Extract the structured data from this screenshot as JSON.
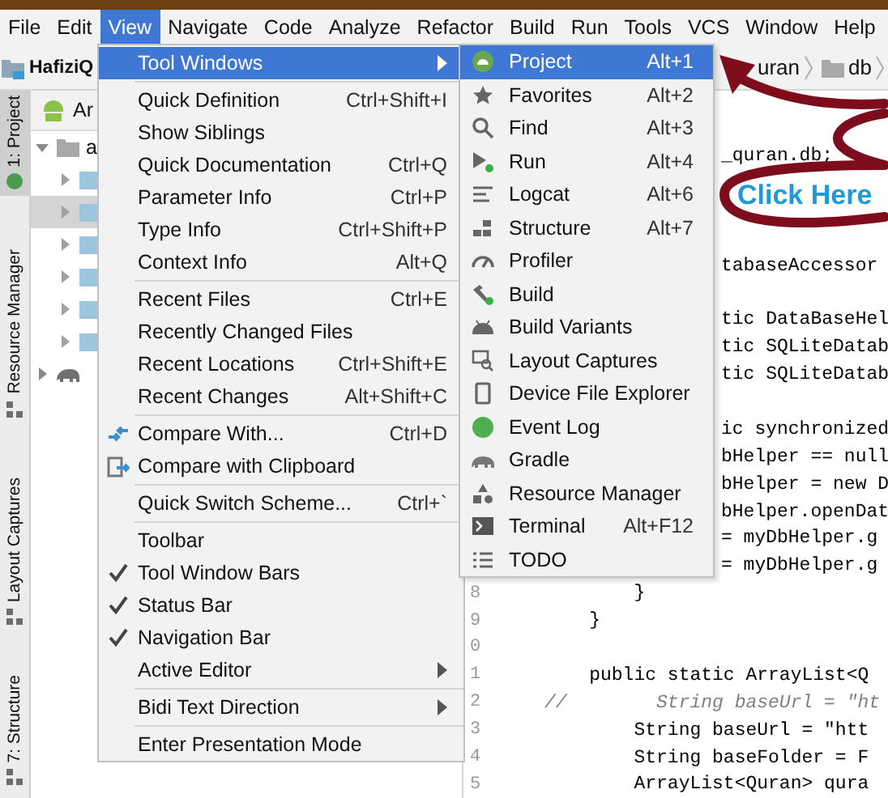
{
  "menu_bar": [
    {
      "label": "File",
      "selected": false
    },
    {
      "label": "Edit",
      "selected": false
    },
    {
      "label": "View",
      "selected": true
    },
    {
      "label": "Navigate",
      "selected": false
    },
    {
      "label": "Code",
      "selected": false
    },
    {
      "label": "Analyze",
      "selected": false
    },
    {
      "label": "Refactor",
      "selected": false
    },
    {
      "label": "Build",
      "selected": false
    },
    {
      "label": "Run",
      "selected": false
    },
    {
      "label": "Tools",
      "selected": false
    },
    {
      "label": "VCS",
      "selected": false
    },
    {
      "label": "Window",
      "selected": false
    },
    {
      "label": "Help",
      "selected": false
    }
  ],
  "nav_bar": {
    "project": "HafiziQ",
    "crumbs": [
      "uran",
      "db"
    ]
  },
  "side_tabs": [
    {
      "label": "1: Project",
      "selected": true
    },
    {
      "label": "Resource Manager",
      "selected": false
    },
    {
      "label": "Layout Captures",
      "selected": false
    },
    {
      "label": "7: Structure",
      "selected": false
    }
  ],
  "project_panel": {
    "header": "Ar",
    "tree": [
      {
        "label": "a",
        "expanded": true,
        "selected": false,
        "children": [
          {
            "expanded": false,
            "selected": false
          },
          {
            "expanded": false,
            "selected": true
          },
          {
            "expanded": false,
            "selected": false
          },
          {
            "expanded": false,
            "selected": false
          },
          {
            "expanded": false,
            "selected": false
          },
          {
            "expanded": false,
            "selected": false
          }
        ]
      },
      {
        "expanded": false,
        "selected": false
      }
    ]
  },
  "view_menu": [
    [
      {
        "label": "Tool Windows",
        "kind": "submenu",
        "selected": true
      }
    ],
    [
      {
        "label": "Quick Definition",
        "shortcut": "Ctrl+Shift+I",
        "kind": "plain",
        "selected": false
      },
      {
        "label": "Show Siblings",
        "kind": "plain",
        "selected": false
      },
      {
        "label": "Quick Documentation",
        "shortcut": "Ctrl+Q",
        "kind": "plain",
        "selected": false
      },
      {
        "label": "Parameter Info",
        "shortcut": "Ctrl+P",
        "kind": "plain",
        "selected": false
      },
      {
        "label": "Type Info",
        "shortcut": "Ctrl+Shift+P",
        "kind": "plain",
        "selected": false
      },
      {
        "label": "Context Info",
        "shortcut": "Alt+Q",
        "kind": "plain",
        "selected": false
      }
    ],
    [
      {
        "label": "Recent Files",
        "shortcut": "Ctrl+E",
        "kind": "plain",
        "selected": false
      },
      {
        "label": "Recently Changed Files",
        "kind": "plain",
        "selected": false
      },
      {
        "label": "Recent Locations",
        "shortcut": "Ctrl+Shift+E",
        "kind": "plain",
        "selected": false
      },
      {
        "label": "Recent Changes",
        "shortcut": "Alt+Shift+C",
        "kind": "plain",
        "selected": false
      }
    ],
    [
      {
        "label": "Compare With...",
        "shortcut": "Ctrl+D",
        "kind": "plain",
        "selected": false
      },
      {
        "label": "Compare with Clipboard",
        "kind": "plain",
        "selected": false
      }
    ],
    [
      {
        "label": "Quick Switch Scheme...",
        "shortcut": "Ctrl+`",
        "kind": "plain",
        "selected": false
      }
    ],
    [
      {
        "label": "Toolbar",
        "kind": "toggle",
        "checked": false,
        "selected": false
      },
      {
        "label": "Tool Window Bars",
        "kind": "toggle",
        "checked": true,
        "selected": false
      },
      {
        "label": "Status Bar",
        "kind": "toggle",
        "checked": true,
        "selected": false
      },
      {
        "label": "Navigation Bar",
        "kind": "toggle",
        "checked": true,
        "selected": false
      },
      {
        "label": "Active Editor",
        "kind": "submenu",
        "selected": false
      }
    ],
    [
      {
        "label": "Bidi Text Direction",
        "kind": "submenu",
        "selected": false
      }
    ],
    [
      {
        "label": "Enter Presentation Mode",
        "kind": "plain",
        "selected": false
      }
    ]
  ],
  "tool_windows_menu": [
    {
      "label": "Project",
      "shortcut": "Alt+1",
      "selected": true
    },
    {
      "label": "Favorites",
      "shortcut": "Alt+2",
      "selected": false
    },
    {
      "label": "Find",
      "shortcut": "Alt+3",
      "selected": false
    },
    {
      "label": "Run",
      "shortcut": "Alt+4",
      "selected": false
    },
    {
      "label": "Logcat",
      "shortcut": "Alt+6",
      "selected": false
    },
    {
      "label": "Structure",
      "shortcut": "Alt+7",
      "selected": false
    },
    {
      "label": "Profiler",
      "selected": false
    },
    {
      "label": "Build",
      "selected": false
    },
    {
      "label": "Build Variants",
      "selected": false
    },
    {
      "label": "Layout Captures",
      "selected": false
    },
    {
      "label": "Device File Explorer",
      "selected": false
    },
    {
      "label": "Event Log",
      "selected": false
    },
    {
      "label": "Gradle",
      "selected": false
    },
    {
      "label": "Resource Manager",
      "selected": false
    },
    {
      "label": "Terminal",
      "shortcut": "Alt+F12",
      "selected": false
    },
    {
      "label": "TODO",
      "selected": false
    }
  ],
  "editor_lines": [
    {
      "kind": "covered",
      "text": "_quran.db;"
    },
    {
      "kind": "blank"
    },
    {
      "kind": "blank"
    },
    {
      "kind": "blank"
    },
    {
      "kind": "covered",
      "text": "tabaseAccessor"
    },
    {
      "kind": "blank"
    },
    {
      "kind": "covered",
      "text": "tic DataBaseHel"
    },
    {
      "kind": "covered",
      "text": "tic SQLiteDatab"
    },
    {
      "kind": "covered",
      "text": "tic SQLiteDatab"
    },
    {
      "kind": "blank"
    },
    {
      "kind": "covered",
      "text": "ic synchronized"
    },
    {
      "kind": "covered",
      "text": "bHelper == null"
    },
    {
      "kind": "covered",
      "text": "bHelper = new D"
    },
    {
      "kind": "covered",
      "text": "bHelper.openDat"
    },
    {
      "kind": "covered",
      "text": "= myDbHelper.g"
    },
    {
      "kind": "covered",
      "text": "= myDbHelper.g"
    },
    {
      "number": "8",
      "kind": "code",
      "text": "        }"
    },
    {
      "number": "9",
      "kind": "code",
      "text": "    }"
    },
    {
      "number": "0",
      "kind": "blank"
    },
    {
      "number": "1",
      "kind": "code",
      "text": "    public static ArrayList<Q"
    },
    {
      "number": "2",
      "kind": "comment",
      "text": "//        String baseUrl = \"ht"
    },
    {
      "number": "3",
      "kind": "code",
      "text": "        String baseUrl = \"htt"
    },
    {
      "number": "4",
      "kind": "code",
      "text": "        String baseFolder = F"
    },
    {
      "number": "5",
      "kind": "code",
      "text": "        ArrayList<Quran> qura"
    }
  ],
  "annotation": {
    "label": "Click Here"
  }
}
